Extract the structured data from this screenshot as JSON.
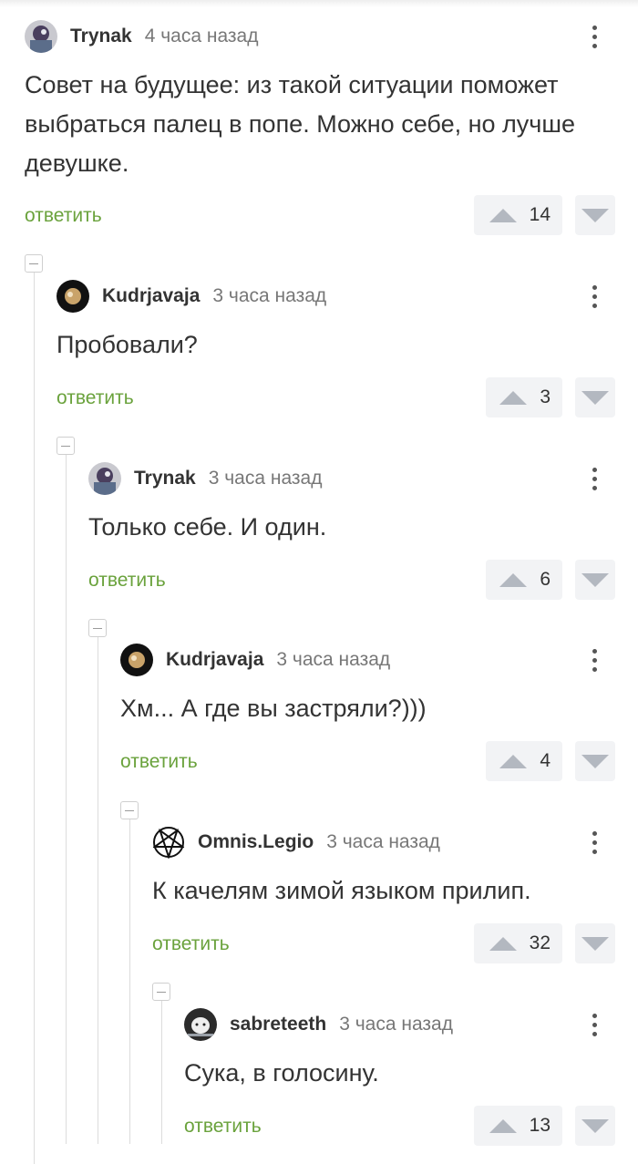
{
  "comments": [
    {
      "author": "Trynak",
      "time": "4 часа назад",
      "text": "Совет на будущее: из такой ситуации поможет выбраться палец в попе. Можно себе, но лучше девушке.",
      "reply": "ответить",
      "score": "14",
      "avatar": "trynak-avatar"
    },
    {
      "author": "Kudrjavaja",
      "time": "3 часа назад",
      "text": "Пробовали?",
      "reply": "ответить",
      "score": "3",
      "avatar": "kudrjavaja-avatar"
    },
    {
      "author": "Trynak",
      "time": "3 часа назад",
      "text": "Только себе. И один.",
      "reply": "ответить",
      "score": "6",
      "avatar": "trynak-avatar"
    },
    {
      "author": "Kudrjavaja",
      "time": "3 часа назад",
      "text": "Хм... А где вы застряли?)))",
      "reply": "ответить",
      "score": "4",
      "avatar": "kudrjavaja-avatar"
    },
    {
      "author": "Omnis.Legio",
      "time": "3 часа назад",
      "text": "К качелям зимой языком прилип.",
      "reply": "ответить",
      "score": "32",
      "avatar": "pentagram-avatar"
    },
    {
      "author": "sabreteeth",
      "time": "3 часа назад",
      "text": "Сука, в голосину.",
      "reply": "ответить",
      "score": "13",
      "avatar": "sabreteeth-avatar"
    }
  ],
  "colors": {
    "reply": "#6aa23c",
    "vote_bg": "#f2f3f5",
    "arrow": "#b3b8c0",
    "thread": "#dcdcdc"
  },
  "icons": [
    "more-icon",
    "upvote-icon",
    "downvote-icon",
    "collapse-icon"
  ]
}
